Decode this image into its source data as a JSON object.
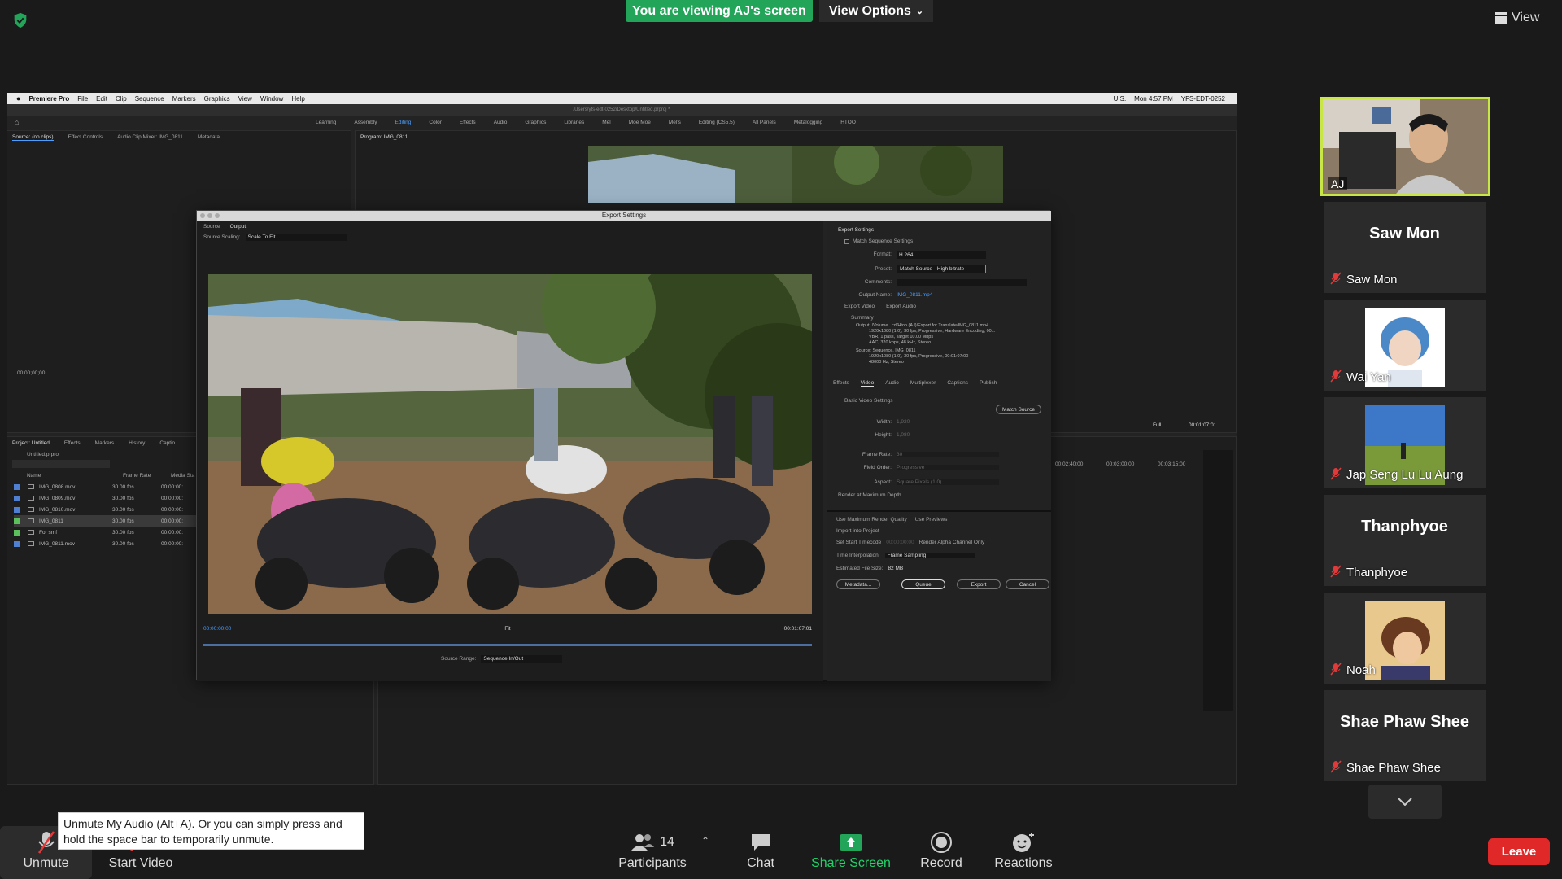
{
  "zoom": {
    "banner": "You are viewing AJ's screen",
    "view_options": "View Options",
    "view_label": "View"
  },
  "mac_menu": {
    "app": "Premiere Pro",
    "items": [
      "File",
      "Edit",
      "Clip",
      "Sequence",
      "Markers",
      "Graphics",
      "View",
      "Window",
      "Help"
    ],
    "right": [
      "U.S.",
      "Mon 4:57 PM",
      "YFS-EDT-0252"
    ]
  },
  "premiere": {
    "path": "/Users/yfs-edt-0252/Desktop/Untitled.prproj *",
    "workspaces": [
      "Learning",
      "Assembly",
      "Editing",
      "Color",
      "Effects",
      "Audio",
      "Graphics",
      "Libraries",
      "Mel",
      "Moe Moe",
      "Mel's",
      "Editing (CS5.5)",
      "All Panels",
      "Metalogging",
      "HTOO"
    ],
    "active_workspace": "Editing",
    "source_tabs": [
      "Source: (no clips)",
      "Effect Controls",
      "Audio Clip Mixer: IMG_0811",
      "Metadata"
    ],
    "program_tab": "Program: IMG_0811",
    "source_timecode": "00;00;00;00",
    "program_timecode": "00:01:07:01",
    "program_zoom": "Full",
    "ruler_times": [
      "00:02:40:00",
      "00:03:00:00",
      "00:03:15:00"
    ],
    "project_tabs": [
      "Project: Untitled",
      "Effects",
      "Markers",
      "History",
      "Captio"
    ],
    "project_file": "Untitled.prproj",
    "project_columns": [
      "Name",
      "Frame Rate",
      "Media Sta"
    ],
    "project_items": [
      {
        "name": "IMG_0808.mov",
        "rate": "30.00 fps",
        "start": "00:00:00:",
        "color": "#4f7fd0"
      },
      {
        "name": "IMG_0809.mov",
        "rate": "30.00 fps",
        "start": "00:00:00:",
        "color": "#4f7fd0"
      },
      {
        "name": "IMG_0810.mov",
        "rate": "30.00 fps",
        "start": "00:00:00:",
        "color": "#4f7fd0"
      },
      {
        "name": "IMG_0811",
        "rate": "30.00 fps",
        "start": "00:00:00:",
        "color": "#5bbf5b"
      },
      {
        "name": "For smf",
        "rate": "30.00 fps",
        "start": "00:00:00:",
        "color": "#5bbf5b"
      },
      {
        "name": "IMG_0811.mov",
        "rate": "30.00 fps",
        "start": "00:00:00:",
        "color": "#4f7fd0"
      }
    ]
  },
  "export": {
    "title": "Export Settings",
    "tabs": [
      "Source",
      "Output"
    ],
    "active_tab": "Output",
    "source_scaling_label": "Source Scaling:",
    "source_scaling_value": "Scale To Fit",
    "start_tc": "00:00:00:00",
    "end_tc": "00:01:07:01",
    "fit": "Fit",
    "source_range_label": "Source Range:",
    "source_range_value": "Sequence In/Out",
    "settings_header": "Export Settings",
    "match_seq": "Match Sequence Settings",
    "format_label": "Format:",
    "format_value": "H.264",
    "preset_label": "Preset:",
    "preset_value": "Match Source - High bitrate",
    "comments_label": "Comments:",
    "output_name_label": "Output Name:",
    "output_name_value": "IMG_0811.mp4",
    "export_video": "Export Video",
    "export_audio": "Export Audio",
    "summary_label": "Summary",
    "summary_output": [
      "Output: /Volume...cd/Htoo (AJ)/Export for Translate/IMG_0811.mp4",
      "1920x1080 (1.0), 30 fps, Progressive, Hardware Encoding, 00...",
      "VBR, 1 pass, Target 10.00 Mbps",
      "AAC, 320 kbps, 48 kHz, Stereo"
    ],
    "summary_source": [
      "Source: Sequence, IMG_0811",
      "1920x1080 (1.0), 30 fps, Progressive, 00:01:07:00",
      "48000 Hz, Stereo"
    ],
    "sub_tabs": [
      "Effects",
      "Video",
      "Audio",
      "Multiplexer",
      "Captions",
      "Publish"
    ],
    "active_sub_tab": "Video",
    "basic_video": "Basic Video Settings",
    "match_source": "Match Source",
    "width_label": "Width:",
    "width_value": "1,920",
    "height_label": "Height:",
    "height_value": "1,080",
    "frame_rate_label": "Frame Rate:",
    "frame_rate_value": "30",
    "field_order_label": "Field Order:",
    "field_order_value": "Progressive",
    "aspect_label": "Aspect:",
    "aspect_value": "Square Pixels (1.0)",
    "render_max_depth": "Render at Maximum Depth",
    "use_max_quality": "Use Maximum Render Quality",
    "use_previews": "Use Previews",
    "import_project": "Import into Project",
    "set_start_tc": "Set Start Timecode",
    "set_start_tc_val": "00:00:00:00",
    "render_alpha": "Render Alpha Channel Only",
    "time_interp_label": "Time Interpolation:",
    "time_interp_value": "Frame Sampling",
    "file_size_label": "Estimated File Size:",
    "file_size_value": "82 MB",
    "metadata_btn": "Metadata...",
    "queue_btn": "Queue",
    "export_btn": "Export",
    "cancel_btn": "Cancel"
  },
  "participants": {
    "self": "AJ",
    "tiles": [
      "Saw Mon",
      "Wai Yan",
      "Jap Seng Lu Lu Aung",
      "Thanphyoe",
      "Noah",
      "Shae Phaw Shee"
    ],
    "big": {
      "saw": "Saw Mon",
      "than": "Thanphyoe",
      "shae": "Shae Phaw Shee"
    }
  },
  "toolbar": {
    "unmute": "Unmute",
    "start_video": "Start Video",
    "participants": "Participants",
    "participants_count": "14",
    "chat": "Chat",
    "share_screen": "Share Screen",
    "record": "Record",
    "reactions": "Reactions",
    "leave": "Leave",
    "tooltip": "Unmute My Audio (Alt+A). Or you can simply press and hold the space bar to temporarily unmute."
  },
  "colors": {
    "zoom_green": "#23a559",
    "active_speaker": "#c8e645",
    "leave_red": "#e02828",
    "premiere_blue": "#4a9eff"
  }
}
